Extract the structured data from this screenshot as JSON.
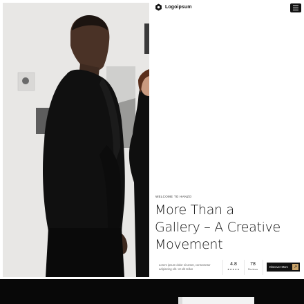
{
  "brand": {
    "name": "Logoipsum",
    "icon": "hexagon-logo-icon"
  },
  "header": {
    "menu_icon": "hamburger-menu-icon"
  },
  "hero": {
    "image": "photo-man-in-black-suit-gallery",
    "eyebrow": "WELCOME TO HANZO",
    "headline_lines": [
      "More Than a",
      "Gallery – A Creative",
      "Movement"
    ],
    "description": "Lorem ipsum dolor sit amet, consectetur adipiscing elit. Ut elit tellus",
    "rating": {
      "value": "4.8",
      "stars": "★★★★★"
    },
    "reviews": {
      "value": "78",
      "label": "Reviews"
    },
    "cta": {
      "label": "Discover More",
      "icon": "arrow-up-right-icon"
    }
  },
  "colors": {
    "accent": "#c9a36a",
    "dark": "#080808",
    "text": "#111111"
  }
}
